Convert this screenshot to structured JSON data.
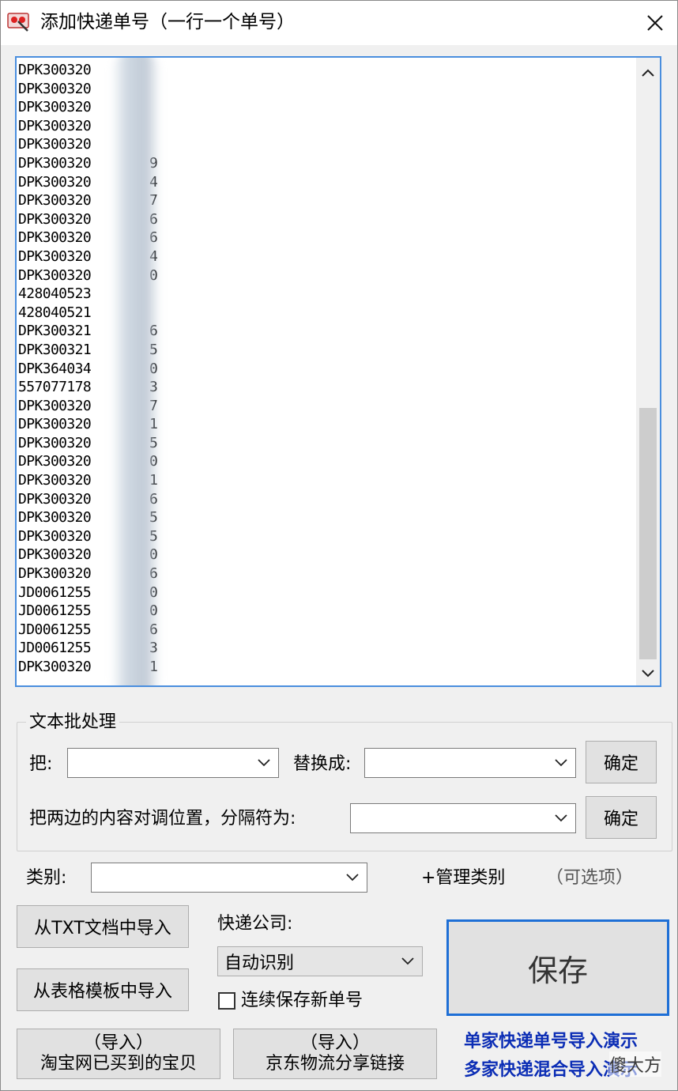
{
  "window": {
    "title": "添加快递单号（一行一个单号）"
  },
  "tracking_lines": [
    {
      "prefix": "DPK300320",
      "tail": ""
    },
    {
      "prefix": "DPK300320",
      "tail": ""
    },
    {
      "prefix": "DPK300320",
      "tail": ""
    },
    {
      "prefix": "DPK300320",
      "tail": ""
    },
    {
      "prefix": "DPK300320",
      "tail": ""
    },
    {
      "prefix": "DPK300320",
      "tail": "9"
    },
    {
      "prefix": "DPK300320",
      "tail": "4"
    },
    {
      "prefix": "DPK300320",
      "tail": "7"
    },
    {
      "prefix": "DPK300320",
      "tail": "6"
    },
    {
      "prefix": "DPK300320",
      "tail": "6"
    },
    {
      "prefix": "DPK300320",
      "tail": "4"
    },
    {
      "prefix": "DPK300320",
      "tail": "0"
    },
    {
      "prefix": "428040523",
      "tail": ""
    },
    {
      "prefix": "428040521",
      "tail": ""
    },
    {
      "prefix": "DPK300321",
      "tail": "6"
    },
    {
      "prefix": "DPK300321",
      "tail": "5"
    },
    {
      "prefix": "DPK364034",
      "tail": "0"
    },
    {
      "prefix": "557077178",
      "tail": "3"
    },
    {
      "prefix": "DPK300320",
      "tail": "7"
    },
    {
      "prefix": "DPK300320",
      "tail": "1"
    },
    {
      "prefix": "DPK300320",
      "tail": "5"
    },
    {
      "prefix": "DPK300320",
      "tail": "0"
    },
    {
      "prefix": "DPK300320",
      "tail": "1"
    },
    {
      "prefix": "DPK300320",
      "tail": "6"
    },
    {
      "prefix": "DPK300320",
      "tail": "5"
    },
    {
      "prefix": "DPK300320",
      "tail": "5"
    },
    {
      "prefix": "DPK300320",
      "tail": "0"
    },
    {
      "prefix": "DPK300320",
      "tail": "6"
    },
    {
      "prefix": "JD0061255",
      "tail": "0"
    },
    {
      "prefix": "JD0061255",
      "tail": "0"
    },
    {
      "prefix": "JD0061255",
      "tail": "6"
    },
    {
      "prefix": "JD0061255",
      "tail": "3"
    },
    {
      "prefix": "DPK300320",
      "tail": "1"
    }
  ],
  "batch": {
    "group_title": "文本批处理",
    "replace_label": "把:",
    "replace_with_label": "替换成:",
    "confirm1": "确定",
    "swap_label": "把两边的内容对调位置，分隔符为:",
    "confirm2": "确定"
  },
  "category": {
    "label": "类别:",
    "manage_link": "+管理类别",
    "optional_note": "（可选项）"
  },
  "import": {
    "from_txt": "从TXT文档中导入",
    "from_template": "从表格模板中导入",
    "taobao_top": "（导入）",
    "taobao_bottom": "淘宝网已买到的宝贝",
    "jd_top": "（导入）",
    "jd_bottom": "京东物流分享链接"
  },
  "courier": {
    "label": "快递公司:",
    "selected": "自动识别"
  },
  "continuous_save": {
    "label": "连续保存新单号",
    "checked": false
  },
  "save_button": "保存",
  "demo_links": {
    "single": "单家快递单号导入演示",
    "multi": "多家快递混合导入演示"
  },
  "watermark": "傻大方"
}
